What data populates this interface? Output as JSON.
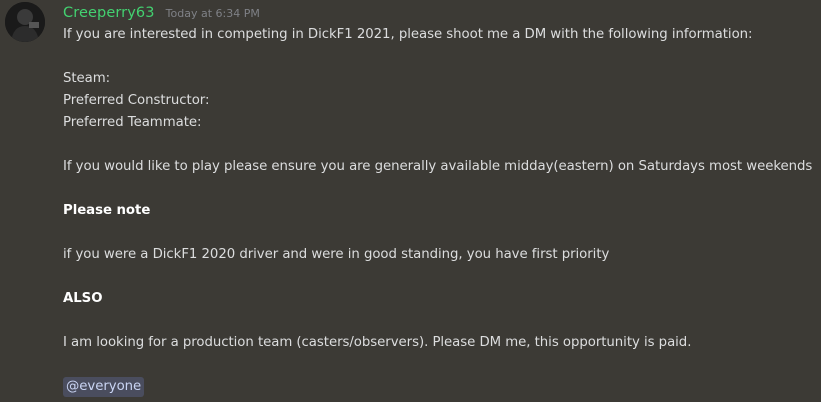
{
  "author": {
    "username": "Creeperry63",
    "timestamp": "Today at 6:34 PM",
    "avatar_icon": "avatar-image"
  },
  "message": {
    "line1": "If you are interested in competing in DickF1 2021, please shoot me a DM with the following information:",
    "steam": "Steam:",
    "constructor": "Preferred Constructor:",
    "teammate": "Preferred Teammate:",
    "availability": "If you would like to play please ensure you are generally available midday(eastern) on Saturdays most weekends",
    "please_note": "Please note",
    "priority": "if you were a DickF1 2020 driver and were in good standing, you have first priority",
    "also": "ALSO",
    "production": "I am looking for a production team (casters/observers). Please DM me, this opportunity is paid.",
    "mention": "@everyone"
  },
  "colors": {
    "background": "#3c3a35",
    "username": "#43d170",
    "text": "#dcddde",
    "mention_bg": "#7289da"
  }
}
